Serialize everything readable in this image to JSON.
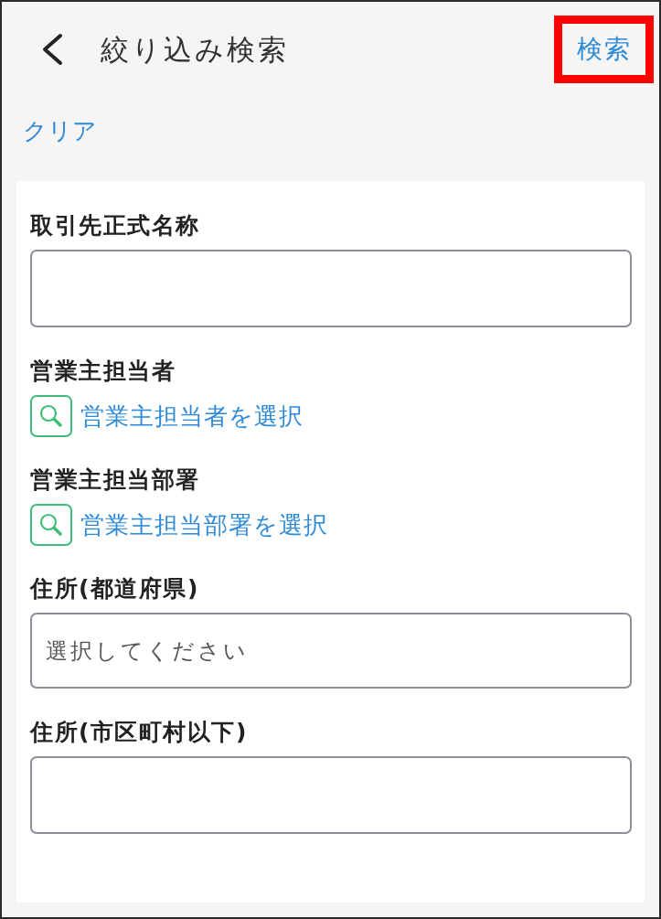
{
  "header": {
    "title": "絞り込み検索",
    "search_button": {
      "label": "検索",
      "highlighted": true
    }
  },
  "clear_link": "クリア",
  "fields": [
    {
      "kind": "text",
      "label": "取引先正式名称"
    },
    {
      "kind": "lookup",
      "label": "営業主担当者",
      "link": "営業主担当者を選択"
    },
    {
      "kind": "lookup",
      "label": "営業主担当部署",
      "link": "営業主担当部署を選択"
    },
    {
      "kind": "select",
      "label": "住所(都道府県)",
      "placeholder": "選択してください"
    },
    {
      "kind": "text",
      "label": "住所(市区町村以下)"
    }
  ]
}
